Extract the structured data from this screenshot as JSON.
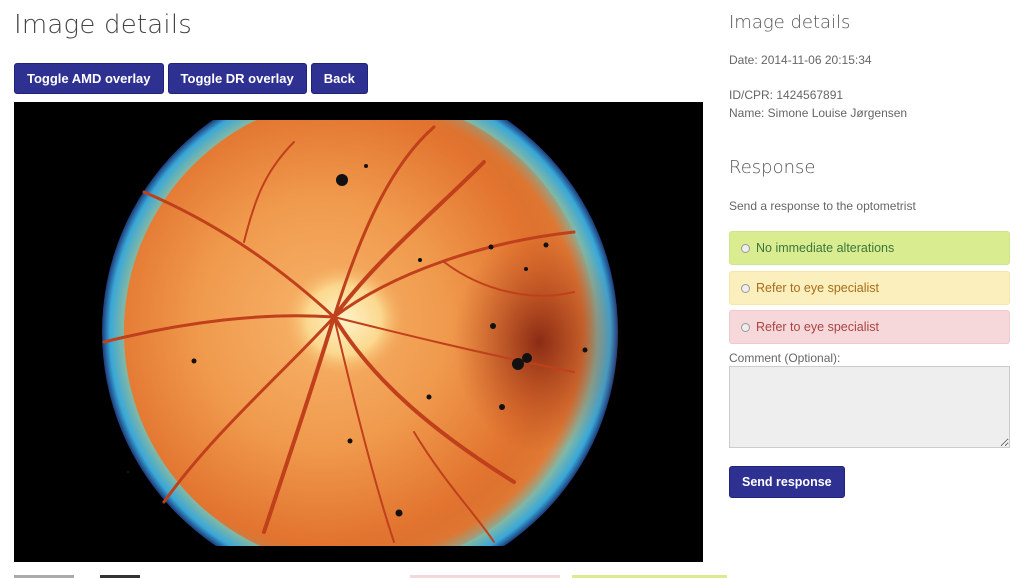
{
  "page": {
    "title": "Image details"
  },
  "toolbar": {
    "amd_label": "Toggle AMD overlay",
    "dr_label": "Toggle DR overlay",
    "back_label": "Back"
  },
  "image": {
    "alt": "Retinal fundus image"
  },
  "details": {
    "title": "Image details",
    "date": "Date: 2014-11-06 20:15:34",
    "id": "ID/CPR: 1424567891",
    "name": "Name: Simone Louise Jørgensen"
  },
  "response": {
    "title": "Response",
    "subtitle": "Send a response to the optometrist",
    "options": [
      {
        "label": "No immediate alterations"
      },
      {
        "label": "Refer to eye specialist"
      },
      {
        "label": "Refer to eye specialist"
      }
    ],
    "comment_label": "Comment (Optional):",
    "send_label": "Send response"
  },
  "colors": {
    "primary_button": "#2e3192",
    "option_green": "#d9ec8f",
    "option_yellow": "#fcefbe",
    "option_red": "#f6d8da"
  }
}
